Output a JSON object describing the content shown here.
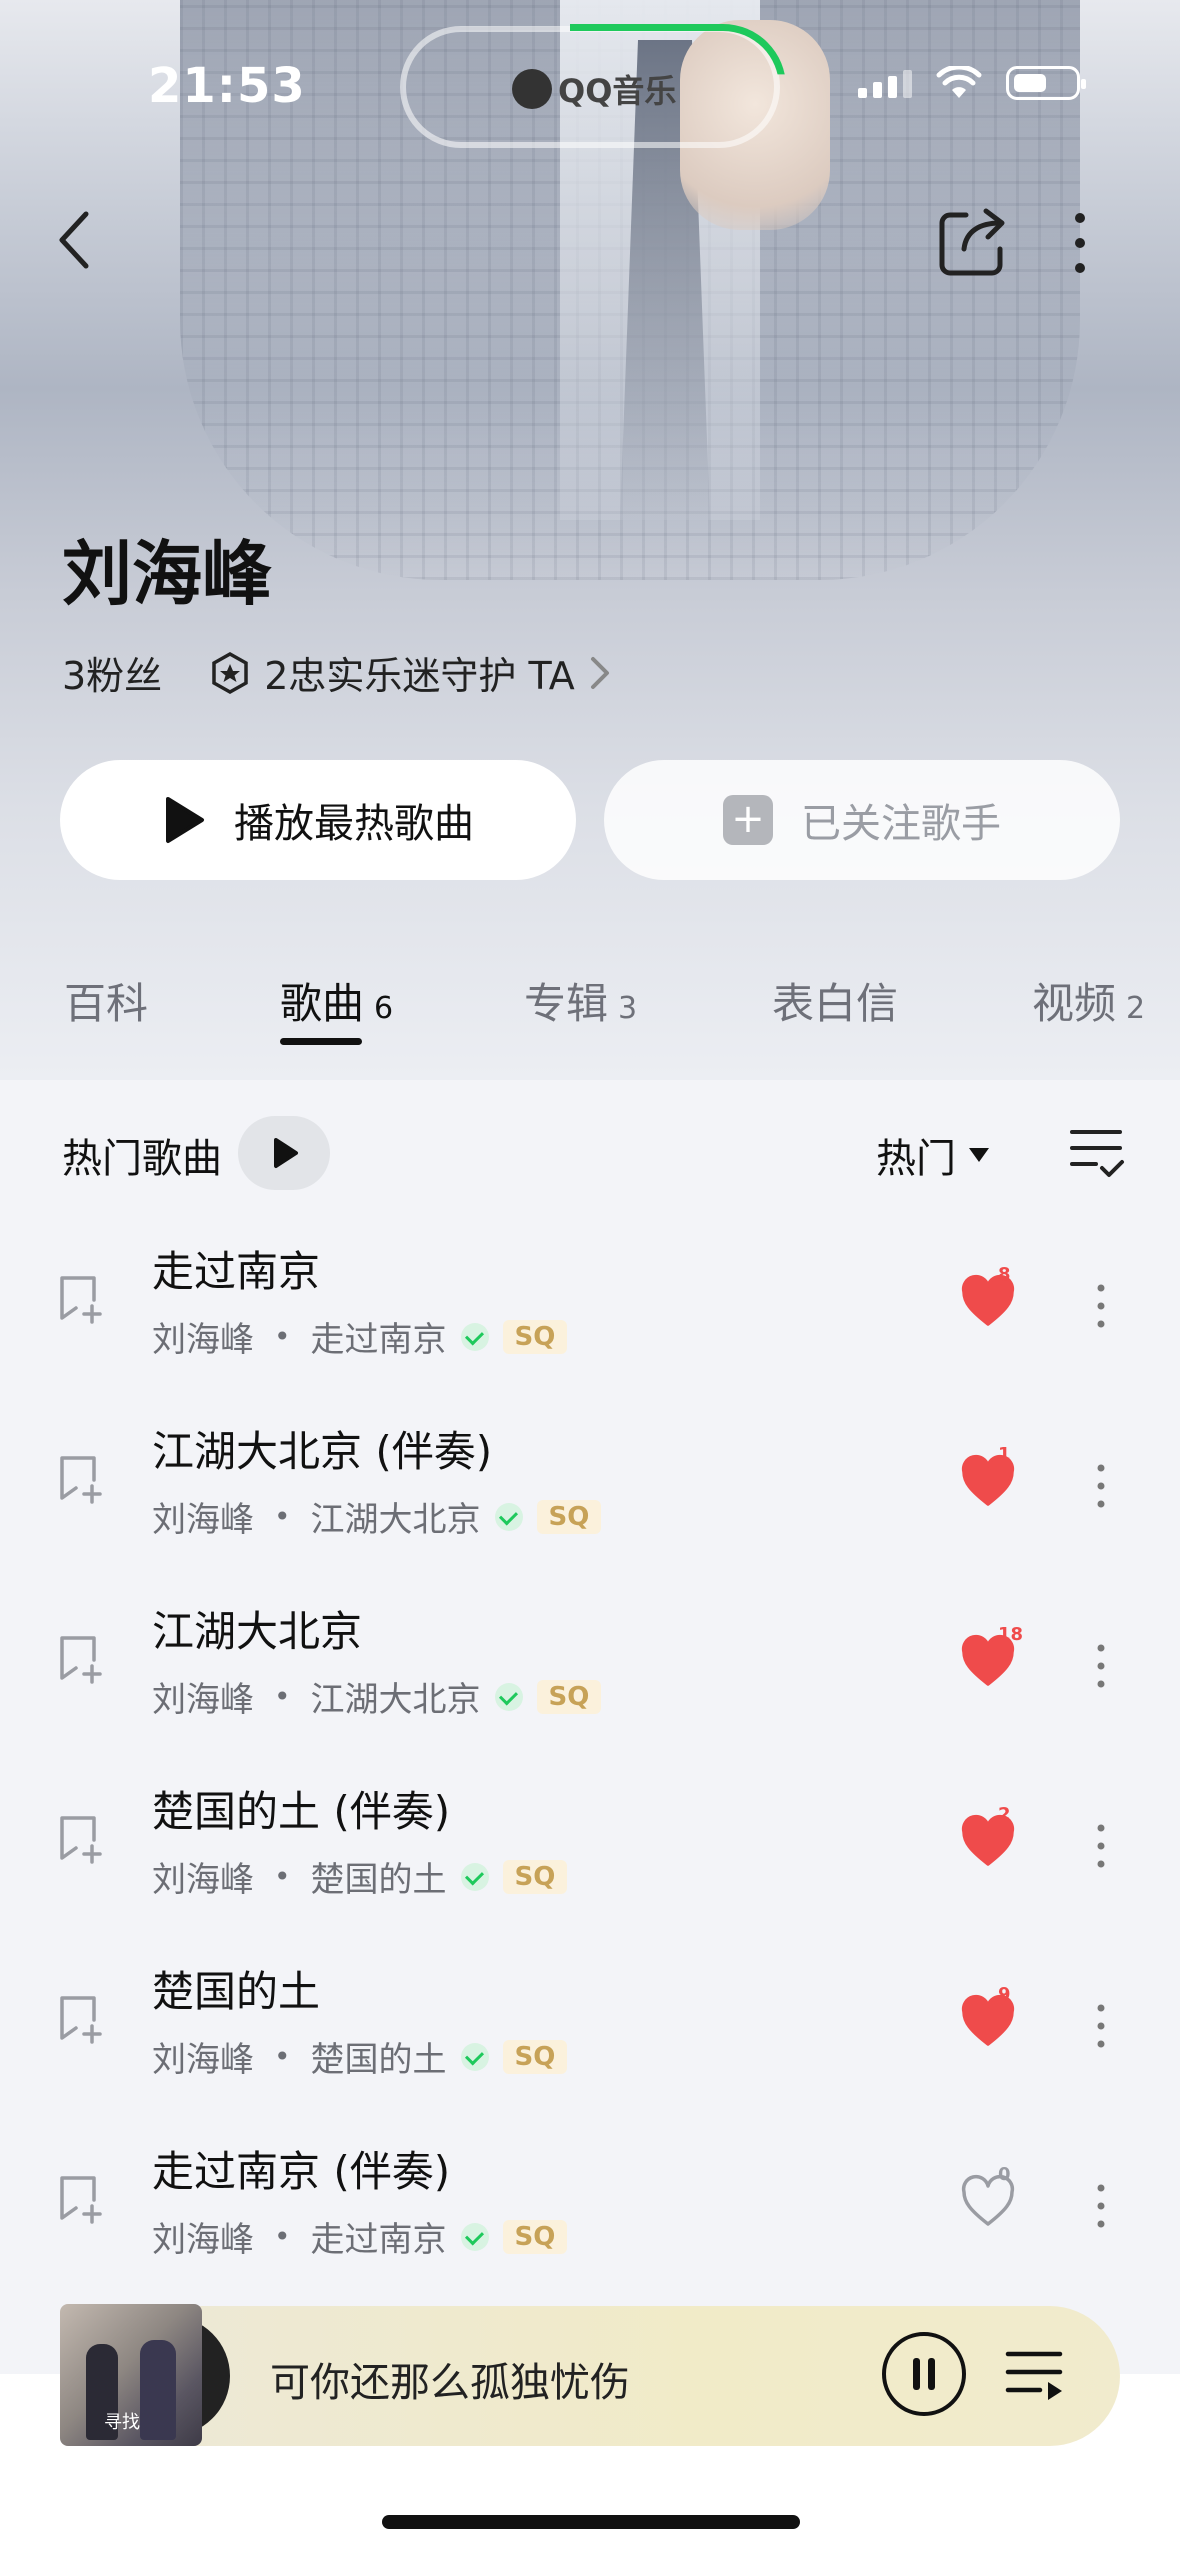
{
  "status_bar": {
    "time": "21:53",
    "island_app": "QQ音乐"
  },
  "header": {
    "back_icon": "chevron-left-icon",
    "share_icon": "share-icon",
    "more_icon": "more-vertical-icon"
  },
  "artist": {
    "name": "刘海峰",
    "fans": "3粉丝",
    "guard_text": "2忠实乐迷守护 TA"
  },
  "actions": {
    "play_hot": "播放最热歌曲",
    "follow": "已关注歌手"
  },
  "tabs": [
    {
      "label": "百科",
      "count": ""
    },
    {
      "label": "歌曲",
      "count": "6"
    },
    {
      "label": "专辑",
      "count": "3"
    },
    {
      "label": "表白信",
      "count": ""
    },
    {
      "label": "视频",
      "count": "2"
    }
  ],
  "list_header": {
    "title": "热门歌曲",
    "sort": "热门"
  },
  "songs": [
    {
      "title": "走过南京",
      "artist": "刘海峰",
      "album": "走过南京",
      "quality": "SQ",
      "likes": "8",
      "liked": true
    },
    {
      "title": "江湖大北京 (伴奏)",
      "artist": "刘海峰",
      "album": "江湖大北京",
      "quality": "SQ",
      "likes": "1",
      "liked": true
    },
    {
      "title": "江湖大北京",
      "artist": "刘海峰",
      "album": "江湖大北京",
      "quality": "SQ",
      "likes": "18",
      "liked": true
    },
    {
      "title": "楚国的土 (伴奏)",
      "artist": "刘海峰",
      "album": "楚国的土",
      "quality": "SQ",
      "likes": "2",
      "liked": true
    },
    {
      "title": "楚国的土",
      "artist": "刘海峰",
      "album": "楚国的土",
      "quality": "SQ",
      "likes": "9",
      "liked": true
    },
    {
      "title": "走过南京 (伴奏)",
      "artist": "刘海峰",
      "album": "走过南京",
      "quality": "SQ",
      "likes": "0",
      "liked": false
    }
  ],
  "mini_player": {
    "title": "可你还那么孤独忧伤",
    "cover_text": "寻找"
  },
  "colors": {
    "accent_green": "#1ec95c",
    "like_red": "#ef4b4b",
    "sq_gold": "#c7a257"
  }
}
